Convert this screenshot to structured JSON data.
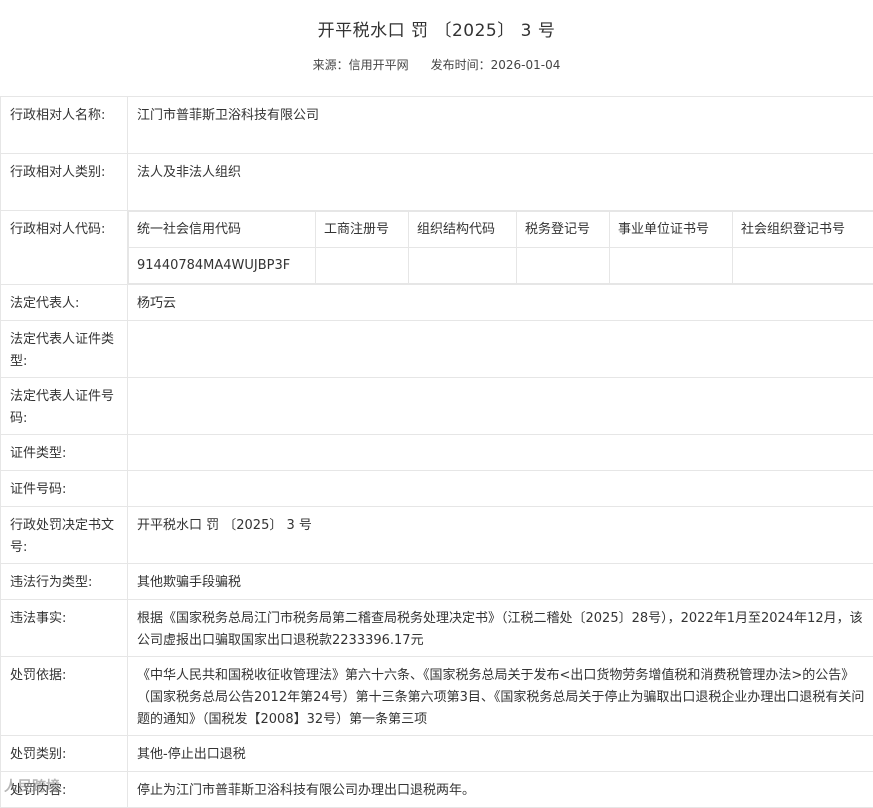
{
  "header": {
    "title": "开平税水口 罚 〔2025〕 3 号",
    "source_label": "来源：",
    "source_value": "信用开平网",
    "date_label": "发布时间：",
    "date_value": "2026-01-04"
  },
  "rows": {
    "name": {
      "label": "行政相对人名称:",
      "value": "江门市普菲斯卫浴科技有限公司"
    },
    "category": {
      "label": "行政相对人类别:",
      "value": "法人及非法人组织"
    },
    "codes": {
      "label": "行政相对人代码:",
      "headers": [
        "统一社会信用代码",
        "工商注册号",
        "组织结构代码",
        "税务登记号",
        "事业单位证书号",
        "社会组织登记书号"
      ],
      "values": [
        "91440784MA4WUJBP3F",
        "",
        "",
        "",
        "",
        ""
      ]
    },
    "legal_rep": {
      "label": "法定代表人:",
      "value": "杨巧云"
    },
    "legal_rep_id_type": {
      "label": "法定代表人证件类型:",
      "value": ""
    },
    "legal_rep_id_no": {
      "label": "法定代表人证件号码:",
      "value": ""
    },
    "id_type": {
      "label": "证件类型:",
      "value": ""
    },
    "id_no": {
      "label": "证件号码:",
      "value": ""
    },
    "decision_no": {
      "label": "行政处罚决定书文号:",
      "value": "开平税水口 罚 〔2025〕 3 号"
    },
    "violation_type": {
      "label": "违法行为类型:",
      "value": "其他欺骗手段骗税"
    },
    "facts": {
      "label": "违法事实:",
      "value": "根据《国家税务总局江门市税务局第二稽查局税务处理决定书》（江税二稽处〔2025〕28号），2022年1月至2024年12月，该公司虚报出口骗取国家出口退税款2233396.17元"
    },
    "basis": {
      "label": "处罚依据:",
      "value": "《中华人民共和国税收征收管理法》第六十六条、《国家税务总局关于发布<出口货物劳务增值税和消费税管理办法>的公告》（国家税务总局公告2012年第24号）第十三条第六项第3目、《国家税务总局关于停止为骗取出口退税企业办理出口退税有关问题的通知》（国税发【2008】32号）第一条第三项"
    },
    "penalty_category": {
      "label": "处罚类别:",
      "value": "其他-停止出口退税"
    },
    "penalty_content": {
      "label": "处罚内容:",
      "value": "停止为江门市普菲斯卫浴科技有限公司办理出口退税两年。"
    }
  },
  "watermark": "人民跨境"
}
